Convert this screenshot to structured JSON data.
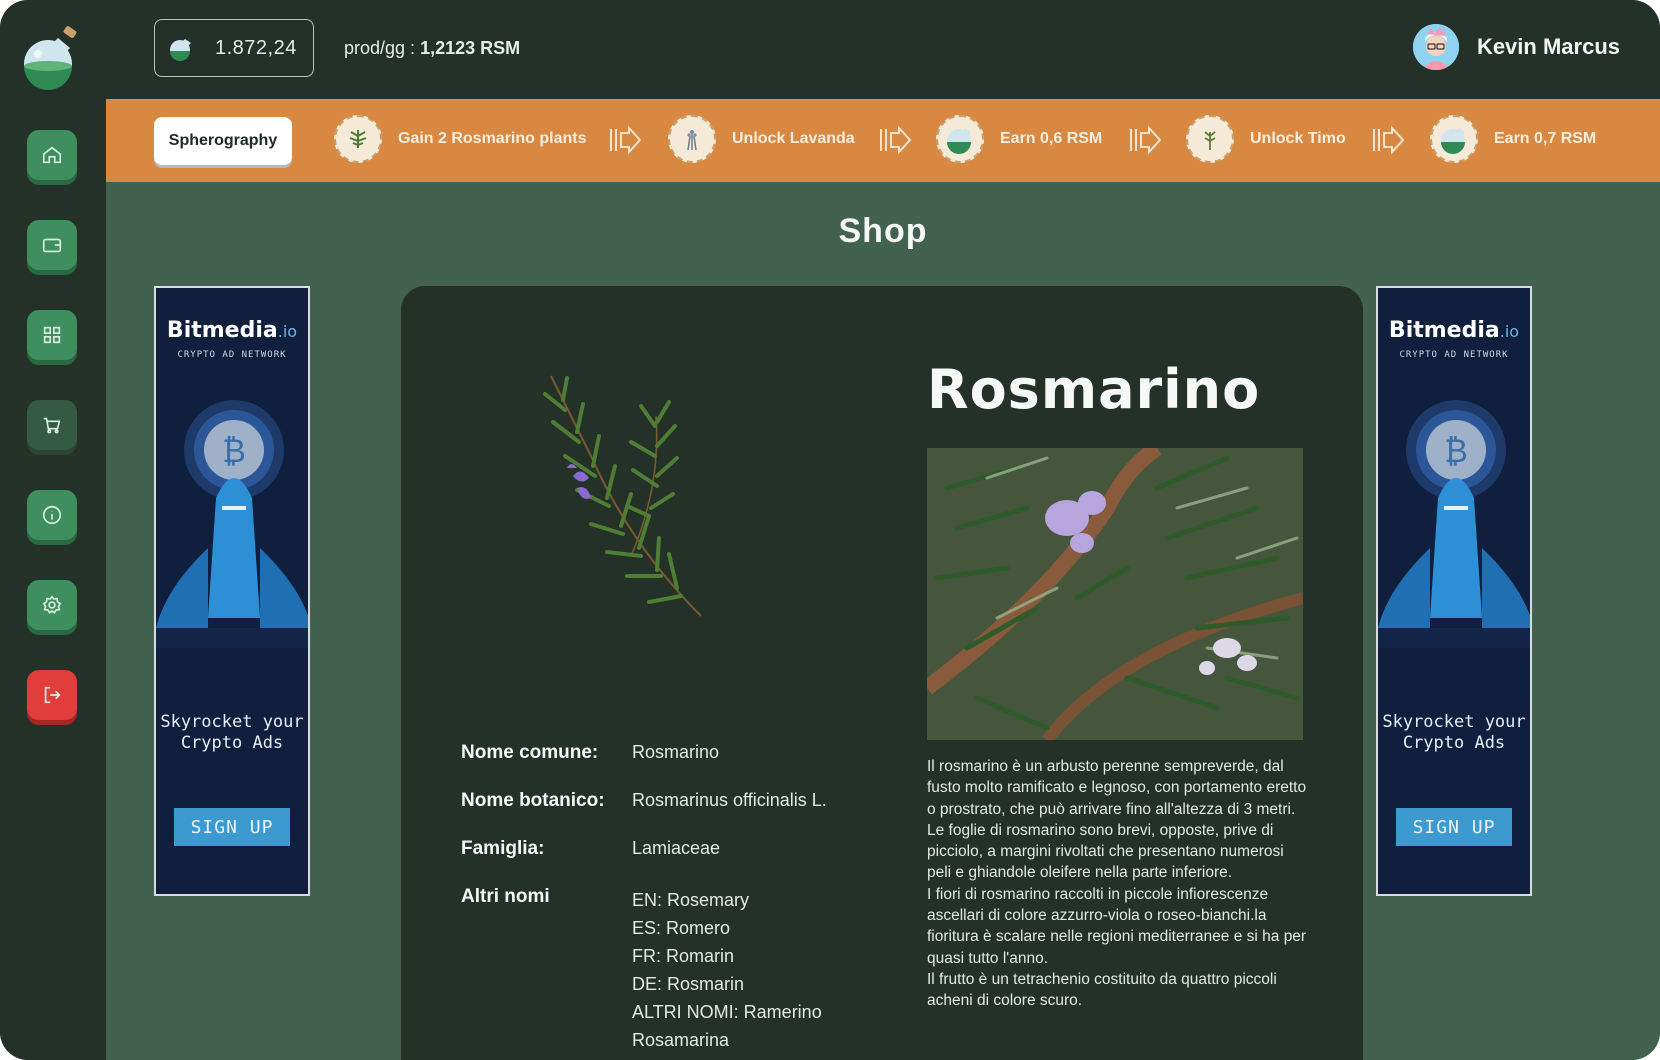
{
  "topbar": {
    "balance": "1.872,24",
    "prod_label": "prod/gg : ",
    "prod_value": "1,2123 RSM",
    "user_name": "Kevin Marcus"
  },
  "sidebar": {
    "items": [
      {
        "icon": "home-icon"
      },
      {
        "icon": "wallet-icon"
      },
      {
        "icon": "grid-icon"
      },
      {
        "icon": "cart-icon"
      },
      {
        "icon": "info-icon"
      },
      {
        "icon": "settings-icon"
      },
      {
        "icon": "logout-icon"
      }
    ]
  },
  "quests": {
    "button_label": "Spherography",
    "items": [
      {
        "label": "Gain 2 Rosmarino plants"
      },
      {
        "label": "Unlock Lavanda"
      },
      {
        "label": "Earn 0,6 RSM"
      },
      {
        "label": "Unlock Timo"
      },
      {
        "label": "Earn 0,7 RSM"
      }
    ]
  },
  "page": {
    "title": "Shop"
  },
  "ads": {
    "brand": "Bitmedia",
    "brand_suffix": ".io",
    "network": "CRYPTO AD NETWORK",
    "tagline": "Skyrocket your Crypto Ads",
    "signup": "SIGN UP"
  },
  "plant": {
    "name": "Rosmarino",
    "facts": {
      "common_label": "Nome comune:",
      "common_value": "Rosmarino",
      "botanical_label": "Nome botanico:",
      "botanical_value": "Rosmarinus officinalis L.",
      "family_label": "Famiglia:",
      "family_value": "Lamiaceae",
      "other_label": "Altri nomi",
      "other_values": [
        "EN: Rosemary",
        "ES: Romero",
        "FR: Romarin",
        "DE: Rosmarin",
        "ALTRI NOMI: Ramerino",
        "Rosamarina"
      ]
    },
    "description": "Il rosmarino è un arbusto perenne sempreverde, dal fusto molto ramificato e legnoso, con portamento eretto o prostrato, che può arrivare fino all'altezza di 3 metri.\nLe foglie di rosmarino sono brevi, opposte, prive di picciolo, a margini rivoltati che presentano numerosi peli e ghiandole oleifere nella parte inferiore.\nI fiori di rosmarino raccolti in piccole infiorescenze ascellari di colore azzurro-viola o roseo-bianchi.la fioritura è scalare nelle regioni mediterranee e si ha per quasi tutto l'anno.\nIl frutto è un tetrachenio costituito da quattro piccoli acheni di colore scuro."
  },
  "colors": {
    "background": "#243129",
    "main": "#42614f",
    "quest_bar": "#d88840",
    "nav_green": "#3f8f5e",
    "nav_red": "#e23d3d"
  }
}
